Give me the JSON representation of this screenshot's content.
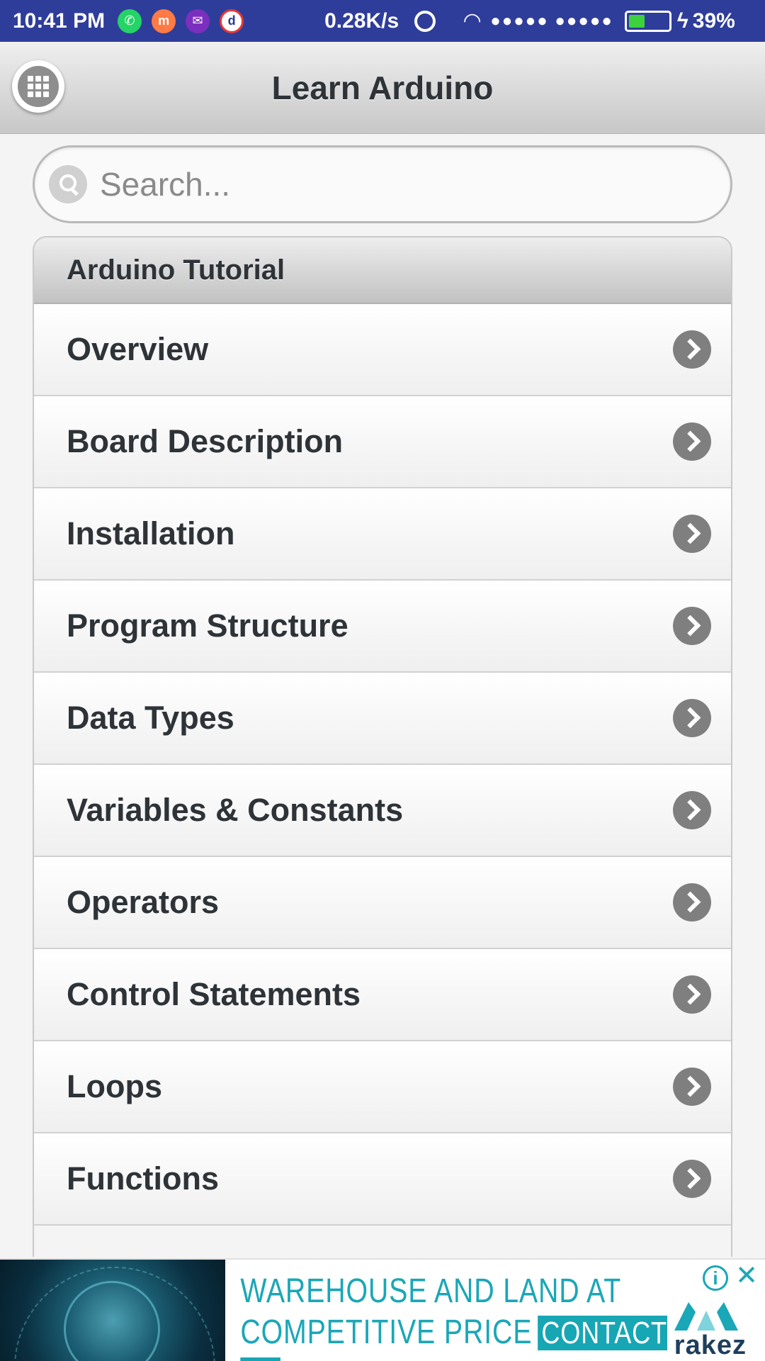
{
  "status_bar": {
    "time": "10:41 PM",
    "network_speed": "0.28K/s",
    "battery_percent": "39%",
    "battery_level": 0.39,
    "app_icons": [
      {
        "name": "whatsapp-icon",
        "color": "#25d366",
        "glyph": "✆"
      },
      {
        "name": "shop-icon",
        "color": "#ff7a45",
        "glyph": "m"
      },
      {
        "name": "mail-icon",
        "color": "#7b2fbe",
        "glyph": "✉"
      },
      {
        "name": "d-app-icon",
        "color": "#2b3a8f",
        "glyph": "d"
      }
    ]
  },
  "header": {
    "title": "Learn Arduino",
    "menu_icon": "grid-icon"
  },
  "search": {
    "placeholder": "Search..."
  },
  "list": {
    "header": "Arduino Tutorial",
    "items": [
      {
        "label": "Overview"
      },
      {
        "label": "Board Description"
      },
      {
        "label": "Installation"
      },
      {
        "label": "Program Structure"
      },
      {
        "label": "Data Types"
      },
      {
        "label": "Variables & Constants"
      },
      {
        "label": "Operators"
      },
      {
        "label": "Control Statements"
      },
      {
        "label": "Loops"
      },
      {
        "label": "Functions"
      }
    ]
  },
  "ad": {
    "line1": "WAREHOUSE AND LAND AT",
    "line2": "COMPETITIVE PRICE",
    "cta": "CONTACT US",
    "brand": "rakez",
    "info_glyph": "i",
    "close_glyph": "✕",
    "accent_color": "#1aa7b7"
  },
  "colors": {
    "status_bar": "#2f3d9a",
    "text": "#2e3338",
    "chevron": "#7f7f7f"
  }
}
